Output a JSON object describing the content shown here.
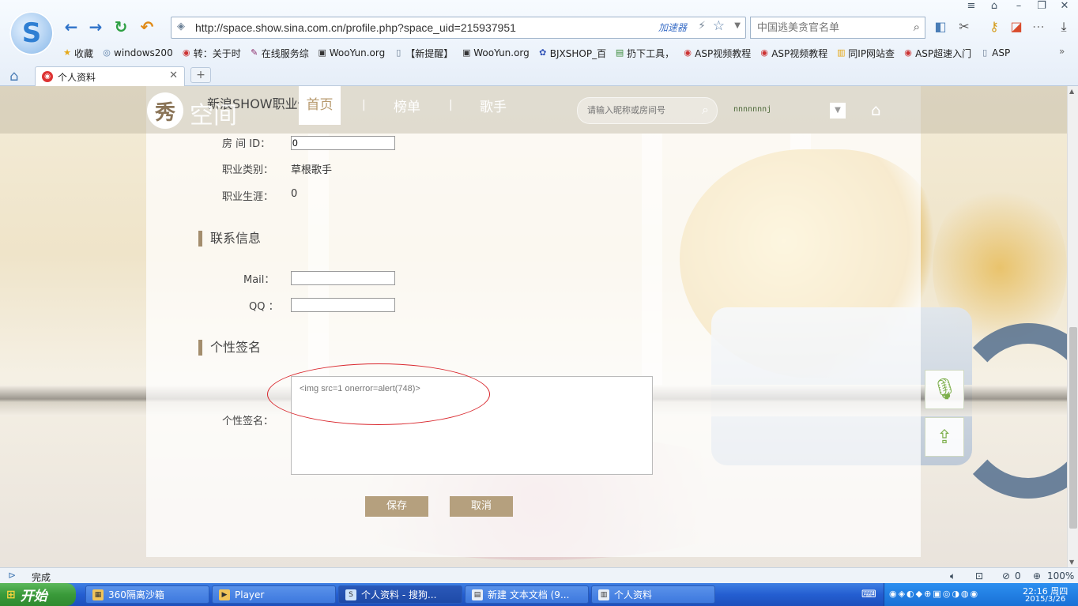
{
  "browser": {
    "url": "http://space.show.sina.com.cn/profile.php?space_uid=215937951",
    "speedup_label": "加速器",
    "search_placeholder": "中国逃美贪官名单",
    "bookmarks": [
      {
        "label": "收藏",
        "icon": "star-icon"
      },
      {
        "label": "windows200",
        "icon": "globe-icon"
      },
      {
        "label": "转：关于时",
        "icon": "weibo-icon"
      },
      {
        "label": "在线服务综",
        "icon": "pen-icon"
      },
      {
        "label": "WooYun.org",
        "icon": "wooyun-icon"
      },
      {
        "label": "【新提醒】",
        "icon": "page-icon"
      },
      {
        "label": "WooYun.org",
        "icon": "wooyun-icon"
      },
      {
        "label": "BJXSHOP_百",
        "icon": "baidu-paw-icon"
      },
      {
        "label": "扔下工具，",
        "icon": "tool-icon"
      },
      {
        "label": "ASP视频教程",
        "icon": "weibo-icon"
      },
      {
        "label": "ASP视频教程",
        "icon": "weibo-icon"
      },
      {
        "label": "同IP网站查",
        "icon": "ip-icon"
      },
      {
        "label": "ASP超速入门",
        "icon": "weibo-icon"
      },
      {
        "label": "ASP",
        "icon": "page-icon"
      }
    ],
    "tab_title": "个人资料"
  },
  "site": {
    "logo_char": "秀",
    "logo_text": "空间",
    "partial_title": "新浪SHOW职业信",
    "nav": {
      "home": "首页",
      "charts": "榜单",
      "singers": "歌手"
    },
    "search_placeholder": "请输入昵称或房间号",
    "username": "nnnnnnnj"
  },
  "form": {
    "room_id_label": "房 间 ID：",
    "room_id_value": "0",
    "category_label": "职业类别：",
    "category_value": "草根歌手",
    "career_label": "职业生涯：",
    "career_value": "0",
    "contact_title": "联系信息",
    "mail_label": "Mail：",
    "mail_value": "",
    "qq_label": "QQ ：",
    "qq_value": "",
    "signature_title": "个性签名",
    "signature_label": "个性签名：",
    "signature_value": "<img src=1 onerror=alert(748)>",
    "save_label": "保存",
    "cancel_label": "取消"
  },
  "statusbar": {
    "status": "完成",
    "counter": "0",
    "zoom": "100%"
  },
  "taskbar": {
    "start_label": "开始",
    "tasks": [
      {
        "label": "360隔离沙箱"
      },
      {
        "label": "Player"
      },
      {
        "label": "个人资料 - 搜狗..."
      },
      {
        "label": "新建 文本文档 (9..."
      },
      {
        "label": "个人资料"
      }
    ],
    "time": "22:16 周四",
    "date": "2015/3/26"
  }
}
